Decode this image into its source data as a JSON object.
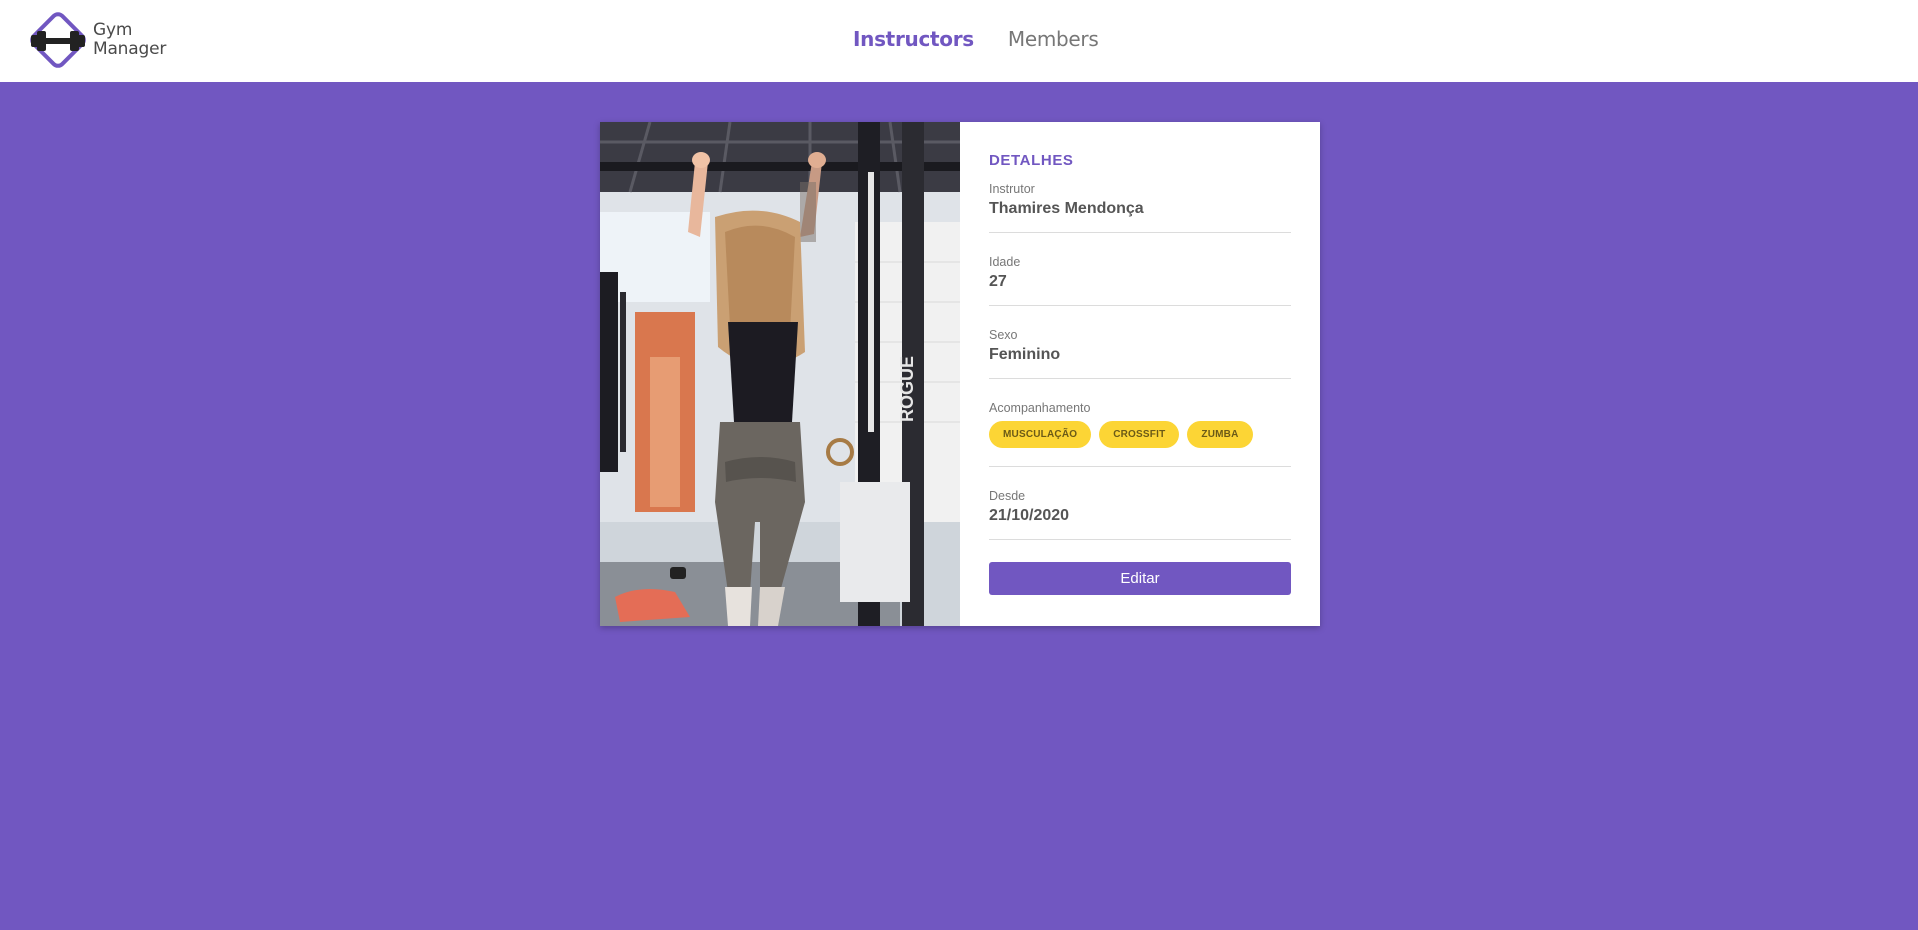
{
  "header": {
    "logo_line1": "Gym",
    "logo_line2": "Manager",
    "nav": [
      {
        "label": "Instructors",
        "active": true
      },
      {
        "label": "Members",
        "active": false
      }
    ]
  },
  "card": {
    "title": "DETALHES",
    "fields": {
      "instructor": {
        "label": "Instrutor",
        "value": "Thamires Mendonça"
      },
      "age": {
        "label": "Idade",
        "value": "27"
      },
      "gender": {
        "label": "Sexo",
        "value": "Feminino"
      },
      "services": {
        "label": "Acompanhamento",
        "tags": [
          "MUSCULAÇÃO",
          "CROSSFIT",
          "ZUMBA"
        ]
      },
      "since": {
        "label": "Desde",
        "value": "21/10/2020"
      }
    },
    "edit_button": "Editar",
    "rack_brand": "ROGUE"
  },
  "colors": {
    "brand": "#7157c1",
    "tag_bg": "#fcd535"
  }
}
